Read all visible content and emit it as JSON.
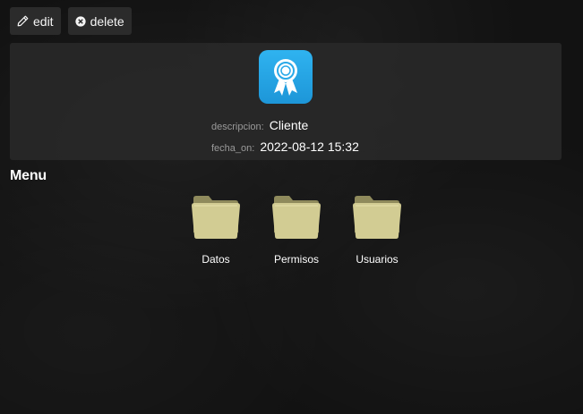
{
  "toolbar": {
    "edit_label": "edit",
    "delete_label": "delete"
  },
  "record": {
    "icon": "award-ribbon-icon",
    "icon_color": "#29a9e8",
    "fields": [
      {
        "label": "descripcion:",
        "value": "Cliente"
      },
      {
        "label": "fecha_on:",
        "value": "2022-08-12 15:32"
      }
    ]
  },
  "menu": {
    "title": "Menu",
    "items": [
      {
        "label": "Datos",
        "icon": "folder-icon"
      },
      {
        "label": "Permisos",
        "icon": "folder-icon"
      },
      {
        "label": "Usuarios",
        "icon": "folder-icon"
      }
    ]
  },
  "colors": {
    "background": "#121212",
    "card": "#2a2a2a",
    "folder": "#c9c48a"
  }
}
